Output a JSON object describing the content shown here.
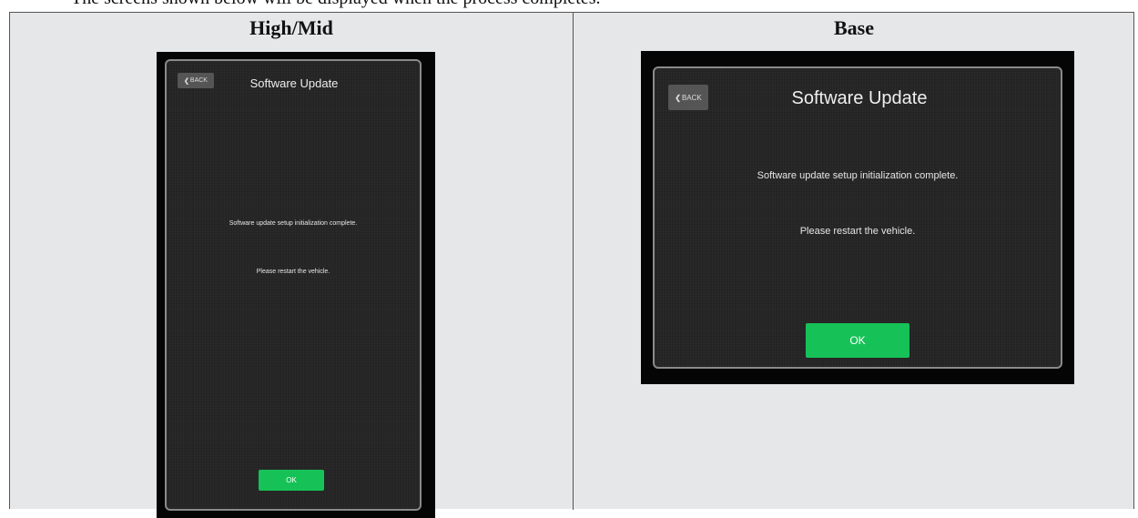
{
  "document": {
    "top_text": "The screens shown below will be displayed when the process completes."
  },
  "columns": [
    {
      "header": "High/Mid",
      "screen": {
        "back_label": "BACK",
        "title": "Software Update",
        "message_line1": "Software update setup initialization complete.",
        "message_line2": "Please restart the vehicle.",
        "ok_label": "OK"
      }
    },
    {
      "header": "Base",
      "screen": {
        "back_label": "BACK",
        "title": "Software Update",
        "message_line1": "Software update setup initialization complete.",
        "message_line2": "Please restart the vehicle.",
        "ok_label": "OK"
      }
    }
  ],
  "colors": {
    "ok_button": "#16c257",
    "screen_background": "#262626",
    "cell_background": "#e6e7e9"
  },
  "icons": {
    "back": "chevron-left-icon"
  }
}
